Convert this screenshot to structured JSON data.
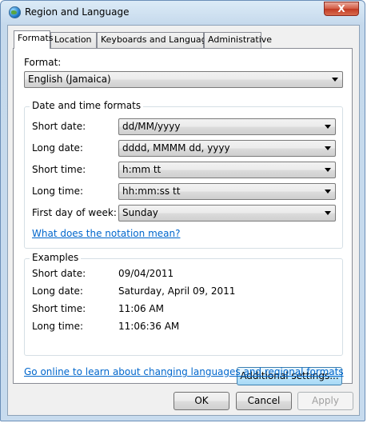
{
  "window": {
    "title": "Region and Language",
    "close_label": "X"
  },
  "tabs": [
    {
      "label": "Formats",
      "active": true
    },
    {
      "label": "Location",
      "active": false
    },
    {
      "label": "Keyboards and Languages",
      "active": false
    },
    {
      "label": "Administrative",
      "active": false
    }
  ],
  "format": {
    "label": "Format:",
    "value": "English (Jamaica)"
  },
  "date_time_formats": {
    "title": "Date and time formats",
    "short_date": {
      "label": "Short date:",
      "value": "dd/MM/yyyy"
    },
    "long_date": {
      "label": "Long date:",
      "value": "dddd, MMMM dd, yyyy"
    },
    "short_time": {
      "label": "Short time:",
      "value": "h:mm tt"
    },
    "long_time": {
      "label": "Long time:",
      "value": "hh:mm:ss tt"
    },
    "first_day": {
      "label": "First day of week:",
      "value": "Sunday"
    },
    "notation_link": "What does the notation mean?"
  },
  "examples": {
    "title": "Examples",
    "rows": [
      {
        "label": "Short date:",
        "value": "09/04/2011"
      },
      {
        "label": "Long date:",
        "value": "Saturday, April 09, 2011"
      },
      {
        "label": "Short time:",
        "value": "11:06 AM"
      },
      {
        "label": "Long time:",
        "value": "11:06:36 AM"
      }
    ]
  },
  "additional_settings_label": "Additional settings...",
  "online_link": "Go online to learn about changing languages and regional formats",
  "buttons": {
    "ok": "OK",
    "cancel": "Cancel",
    "apply": "Apply"
  }
}
